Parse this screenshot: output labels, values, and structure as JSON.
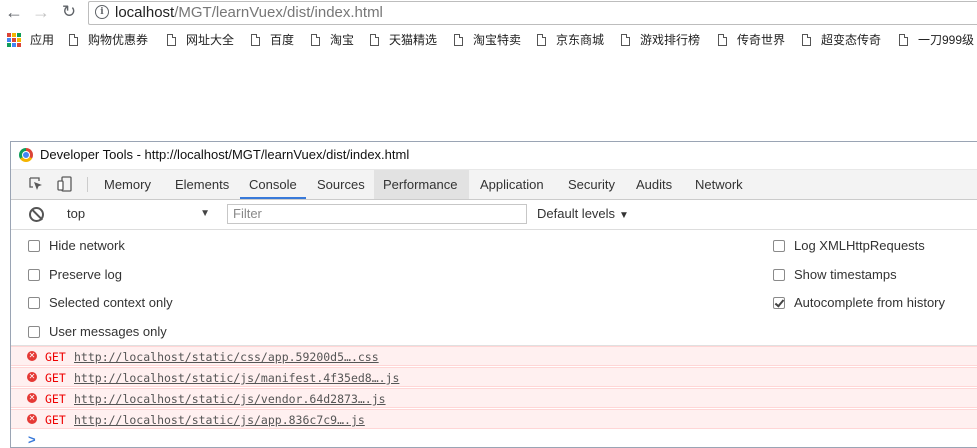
{
  "browser": {
    "url_host": "localhost",
    "url_path": "/MGT/learnVuex/dist/index.html",
    "bookmarks": [
      {
        "label": "应用",
        "type": "apps"
      },
      {
        "label": "购物优惠券"
      },
      {
        "label": "网址大全"
      },
      {
        "label": "百度"
      },
      {
        "label": "淘宝"
      },
      {
        "label": "天猫精选"
      },
      {
        "label": "淘宝特卖"
      },
      {
        "label": "京东商城"
      },
      {
        "label": "游戏排行榜"
      },
      {
        "label": "传奇世界"
      },
      {
        "label": "超变态传奇"
      },
      {
        "label": "一刀999级"
      }
    ]
  },
  "devtools": {
    "window_title": "Developer Tools - http://localhost/MGT/learnVuex/dist/index.html",
    "tabs": [
      {
        "label": "Memory"
      },
      {
        "label": "Elements"
      },
      {
        "label": "Console",
        "active": true
      },
      {
        "label": "Sources"
      },
      {
        "label": "Performance",
        "hover": true
      },
      {
        "label": "Application"
      },
      {
        "label": "Security"
      },
      {
        "label": "Audits"
      },
      {
        "label": "Network"
      }
    ],
    "console_toolbar": {
      "context": "top",
      "filter_placeholder": "Filter",
      "levels": "Default levels"
    },
    "settings": {
      "left": [
        {
          "label": "Hide network",
          "checked": false
        },
        {
          "label": "Preserve log",
          "checked": false
        },
        {
          "label": "Selected context only",
          "checked": false
        },
        {
          "label": "User messages only",
          "checked": false
        }
      ],
      "right": [
        {
          "label": "Log XMLHttpRequests",
          "checked": false
        },
        {
          "label": "Show timestamps",
          "checked": false
        },
        {
          "label": "Autocomplete from history",
          "checked": true
        }
      ]
    },
    "messages": [
      {
        "method": "GET",
        "url": "http://localhost/static/css/app.59200d5….css"
      },
      {
        "method": "GET",
        "url": "http://localhost/static/js/manifest.4f35ed8….js"
      },
      {
        "method": "GET",
        "url": "http://localhost/static/js/vendor.64d2873….js"
      },
      {
        "method": "GET",
        "url": "http://localhost/static/js/app.836c7c9….js"
      }
    ],
    "prompt_symbol": ">"
  },
  "colors": {
    "accent": "#3879d9",
    "error_bg": "#fff0f0",
    "error_text": "#e00000"
  }
}
